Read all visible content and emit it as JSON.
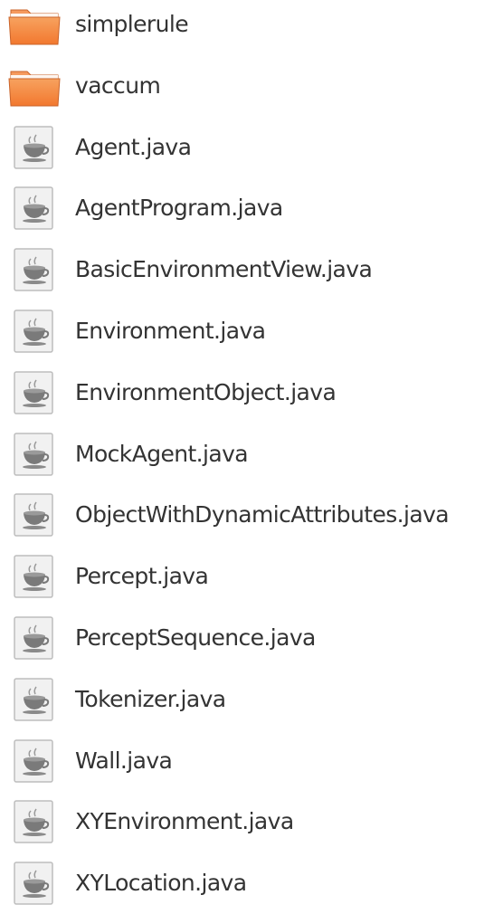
{
  "colors": {
    "folder_body": "#f2782f",
    "folder_tab": "#f59a5e",
    "text": "#333333",
    "file_page": "#f1f1f1",
    "file_border": "#bdbdbd",
    "cup": "#7a7a7a"
  },
  "items": [
    {
      "name": "simplerule",
      "kind": "folder",
      "icon": "folder-icon"
    },
    {
      "name": "vaccum",
      "kind": "folder",
      "icon": "folder-icon"
    },
    {
      "name": "Agent.java",
      "kind": "file",
      "icon": "java-file-icon"
    },
    {
      "name": "AgentProgram.java",
      "kind": "file",
      "icon": "java-file-icon"
    },
    {
      "name": "BasicEnvironmentView.java",
      "kind": "file",
      "icon": "java-file-icon"
    },
    {
      "name": "Environment.java",
      "kind": "file",
      "icon": "java-file-icon"
    },
    {
      "name": "EnvironmentObject.java",
      "kind": "file",
      "icon": "java-file-icon"
    },
    {
      "name": "MockAgent.java",
      "kind": "file",
      "icon": "java-file-icon"
    },
    {
      "name": "ObjectWithDynamicAttributes.java",
      "kind": "file",
      "icon": "java-file-icon"
    },
    {
      "name": "Percept.java",
      "kind": "file",
      "icon": "java-file-icon"
    },
    {
      "name": "PerceptSequence.java",
      "kind": "file",
      "icon": "java-file-icon"
    },
    {
      "name": "Tokenizer.java",
      "kind": "file",
      "icon": "java-file-icon"
    },
    {
      "name": "Wall.java",
      "kind": "file",
      "icon": "java-file-icon"
    },
    {
      "name": "XYEnvironment.java",
      "kind": "file",
      "icon": "java-file-icon"
    },
    {
      "name": "XYLocation.java",
      "kind": "file",
      "icon": "java-file-icon"
    }
  ]
}
